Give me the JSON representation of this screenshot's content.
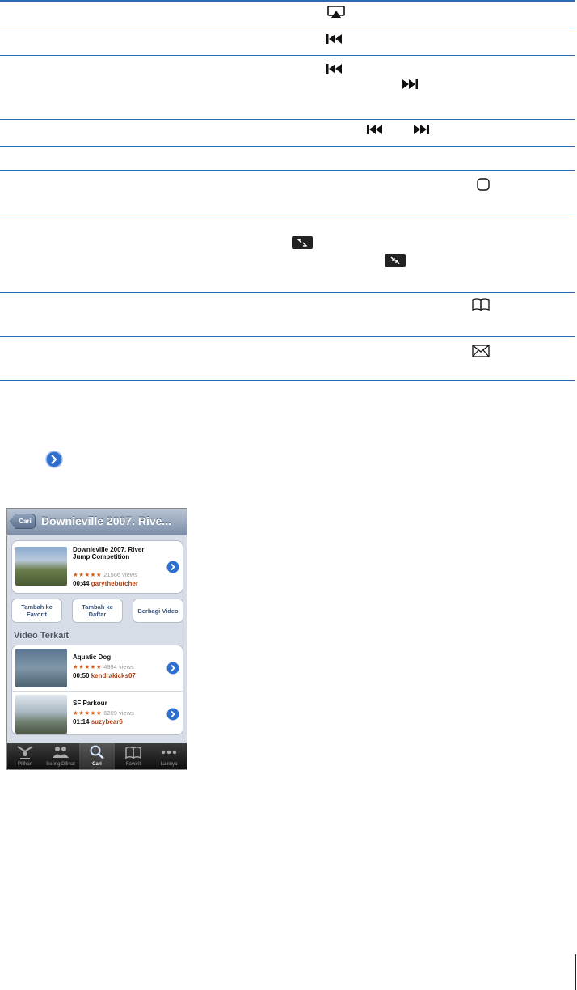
{
  "colors": {
    "rule": "#2b6cb8",
    "accent_link": "#3b5276",
    "star": "#d15d1a",
    "author": "#a8441a"
  },
  "phone": {
    "navbar": {
      "back_label": "Cari",
      "title": "Downieville 2007. Rive..."
    },
    "video": {
      "title": "Downieville 2007. River Jump Competition",
      "stars": "★★★★★",
      "views": "21566 views",
      "duration": "00:44",
      "author": "garythebutcher"
    },
    "actions": [
      {
        "label": "Tambah ke Favorit"
      },
      {
        "label": "Tambah ke Daftar"
      },
      {
        "label": "Berbagi Video"
      }
    ],
    "related_title": "Video Terkait",
    "related": [
      {
        "title": "Aquatic Dog",
        "stars": "★★★★★",
        "views": "4994 views",
        "duration": "00:50",
        "author": "kendrakicks07"
      },
      {
        "title": "SF Parkour",
        "stars": "★★★★★",
        "views": "6209 views",
        "duration": "01:14",
        "author": "suzybear6"
      }
    ],
    "tabs": [
      {
        "label": "Pilihan",
        "icon": "featured-icon"
      },
      {
        "label": "Sering Dilihat",
        "icon": "most-viewed-icon"
      },
      {
        "label": "Cari",
        "icon": "search-icon",
        "selected": true
      },
      {
        "label": "Favorit",
        "icon": "bookmarks-icon"
      },
      {
        "label": "Lainnya",
        "icon": "more-icon"
      }
    ]
  }
}
